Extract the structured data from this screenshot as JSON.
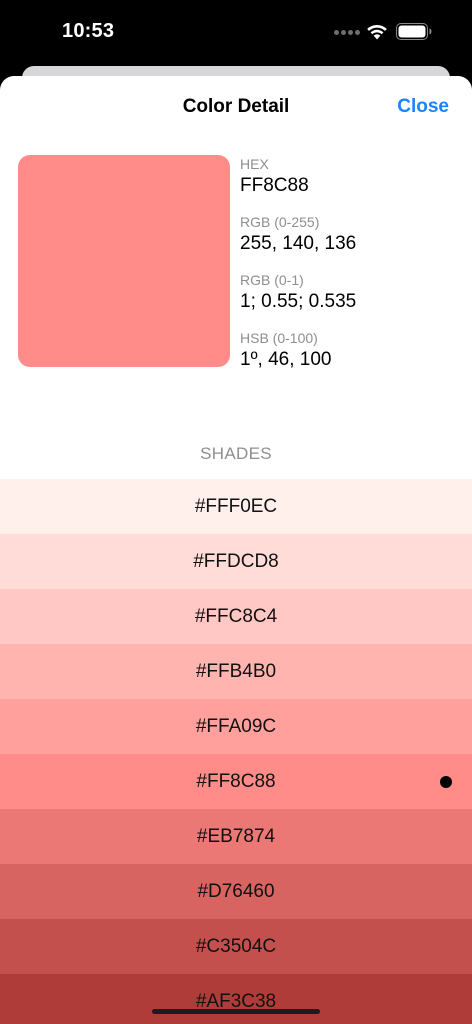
{
  "status_bar": {
    "time": "10:53"
  },
  "nav": {
    "title": "Color Detail",
    "close_label": "Close"
  },
  "color": {
    "swatch_color": "#FF8C88",
    "hex_label": "HEX",
    "hex_value": "FF8C88",
    "rgb255_label": "RGB (0-255)",
    "rgb255_value": "255, 140, 136",
    "rgb1_label": "RGB (0-1)",
    "rgb1_value": "1; 0.55; 0.535",
    "hsb_label": "HSB (0-100)",
    "hsb_value": "1º, 46, 100"
  },
  "shades": {
    "header": "SHADES",
    "items": [
      {
        "label": "#FFF0EC",
        "color": "#FFF0EC",
        "selected": false
      },
      {
        "label": "#FFDCD8",
        "color": "#FFDCD8",
        "selected": false
      },
      {
        "label": "#FFC8C4",
        "color": "#FFC8C4",
        "selected": false
      },
      {
        "label": "#FFB4B0",
        "color": "#FFB4B0",
        "selected": false
      },
      {
        "label": "#FFA09C",
        "color": "#FFA09C",
        "selected": false
      },
      {
        "label": "#FF8C88",
        "color": "#FF8C88",
        "selected": true
      },
      {
        "label": "#EB7874",
        "color": "#EB7874",
        "selected": false
      },
      {
        "label": "#D76460",
        "color": "#D76460",
        "selected": false
      },
      {
        "label": "#C3504C",
        "color": "#C3504C",
        "selected": false
      },
      {
        "label": "#AF3C38",
        "color": "#AF3C38",
        "selected": false
      }
    ]
  }
}
